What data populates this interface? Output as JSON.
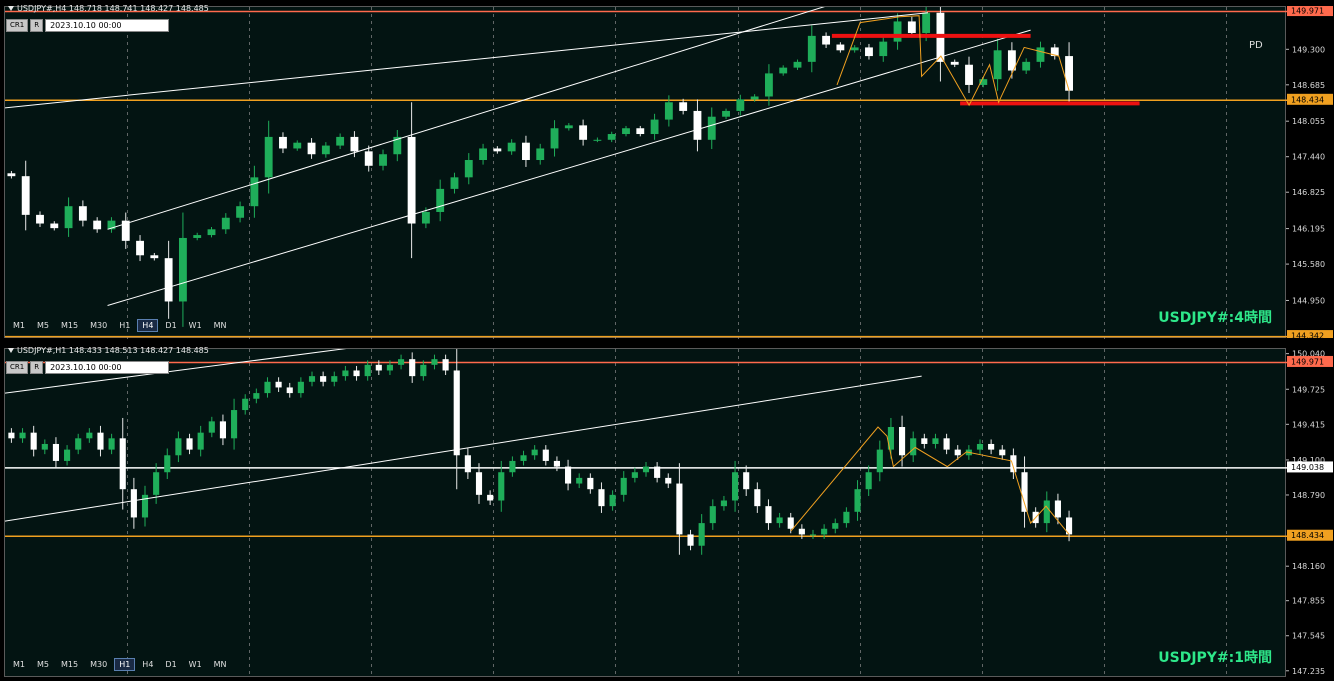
{
  "panels": [
    {
      "header": "USDJPY#,H4  148.718 148.741 148.427 148.485",
      "btn_cr": "CR1",
      "btn_r": "R",
      "datetime": "2023.10.10 00:00",
      "timeframes": [
        "M1",
        "M5",
        "M15",
        "M30",
        "H1",
        "H4",
        "D1",
        "W1",
        "MN"
      ],
      "active_timeframe": "H4",
      "watermark": "USDJPY#:4時間",
      "extra_label": "PD",
      "axis_ticks": [
        "149.300",
        "148.685",
        "148.055",
        "147.440",
        "146.825",
        "146.195",
        "145.580",
        "144.950"
      ],
      "price_tags": [
        {
          "label": "149.971",
          "value": 149.971,
          "color": "#ff6a4d"
        },
        {
          "label": "148.434",
          "value": 148.434,
          "color": "#f0a020"
        },
        {
          "label": "144.342",
          "value": 144.342,
          "color": "#f0a020"
        }
      ]
    },
    {
      "header": "USDJPY#,H1  148.433 148.513 148.427 148.485",
      "btn_cr": "CR1",
      "btn_r": "R",
      "datetime": "2023.10.10 00:00",
      "timeframes": [
        "M1",
        "M5",
        "M15",
        "M30",
        "H1",
        "H4",
        "D1",
        "W1",
        "MN"
      ],
      "active_timeframe": "H1",
      "watermark": "USDJPY#:1時間",
      "axis_ticks": [
        "150.040",
        "149.725",
        "149.415",
        "149.100",
        "148.790",
        "148.160",
        "147.855",
        "147.545",
        "147.235"
      ],
      "price_tags": [
        {
          "label": "149.971",
          "value": 149.971,
          "color": "#ff6a4d"
        },
        {
          "label": "149.038",
          "value": 149.038,
          "color": "#ffffff"
        },
        {
          "label": "148.434",
          "value": 148.434,
          "color": "#f0a020"
        }
      ]
    }
  ],
  "chart_data": [
    {
      "type": "candlestick",
      "symbol": "USDJPY#",
      "timeframe": "H4",
      "ylim": [
        144.3,
        150.05
      ],
      "last": {
        "open": 148.718,
        "high": 148.741,
        "low": 148.427,
        "close": 148.485
      },
      "horizontal_lines": [
        {
          "value": 149.971,
          "color": "#ff6a4d"
        },
        {
          "value": 148.434,
          "color": "#f0a020"
        },
        {
          "value": 144.342,
          "color": "#f0a020"
        }
      ],
      "closes": [
        147.12,
        146.45,
        146.3,
        146.22,
        146.6,
        146.35,
        146.2,
        146.35,
        146.0,
        145.75,
        145.7,
        144.95,
        146.05,
        146.1,
        146.2,
        146.4,
        146.6,
        147.1,
        147.8,
        147.6,
        147.7,
        147.5,
        147.65,
        147.8,
        147.55,
        147.3,
        147.5,
        147.8,
        146.3,
        146.5,
        146.9,
        147.1,
        147.4,
        147.6,
        147.55,
        147.7,
        147.4,
        147.6,
        147.95,
        148.0,
        147.75,
        147.75,
        147.85,
        147.95,
        147.85,
        148.1,
        148.4,
        148.25,
        147.75,
        148.15,
        148.25,
        148.45,
        148.5,
        148.9,
        149.0,
        149.1,
        149.55,
        149.4,
        149.3,
        149.35,
        149.2,
        149.45,
        149.8,
        149.6,
        149.95,
        149.1,
        149.05,
        148.7,
        148.8,
        149.3,
        148.95,
        149.1,
        149.35,
        149.2,
        148.6
      ],
      "white_lines": [
        {
          "from": [
            -0.01,
            148.28
          ],
          "to": [
            0.72,
            149.95
          ]
        },
        {
          "from": [
            0.08,
            146.2
          ],
          "to": [
            0.66,
            150.2
          ]
        },
        {
          "from": [
            0.08,
            144.88
          ],
          "to": [
            0.8,
            149.65
          ]
        }
      ],
      "red_levels": [
        {
          "from": 0.645,
          "to": 0.8,
          "value": 149.55
        },
        {
          "from": 0.745,
          "to": 0.885,
          "value": 148.38
        }
      ],
      "zigzag": [
        {
          "x": 0.649,
          "y": 148.7
        },
        {
          "x": 0.667,
          "y": 149.78
        },
        {
          "x": 0.698,
          "y": 149.88
        },
        {
          "x": 0.713,
          "y": 149.9
        },
        {
          "x": 0.715,
          "y": 148.85
        },
        {
          "x": 0.73,
          "y": 149.2
        },
        {
          "x": 0.752,
          "y": 148.35
        },
        {
          "x": 0.768,
          "y": 149.05
        },
        {
          "x": 0.775,
          "y": 148.4
        },
        {
          "x": 0.795,
          "y": 149.35
        },
        {
          "x": 0.822,
          "y": 149.2
        },
        {
          "x": 0.83,
          "y": 148.6
        }
      ]
    },
    {
      "type": "candlestick",
      "symbol": "USDJPY#",
      "timeframe": "H1",
      "ylim": [
        147.18,
        150.09
      ],
      "last": {
        "open": 148.433,
        "high": 148.513,
        "low": 148.427,
        "close": 148.485
      },
      "horizontal_lines": [
        {
          "value": 149.971,
          "color": "#ff6a4d"
        },
        {
          "value": 149.038,
          "color": "#ffffff"
        },
        {
          "value": 148.434,
          "color": "#f0a020"
        }
      ],
      "closes": [
        149.3,
        149.35,
        149.2,
        149.25,
        149.1,
        149.2,
        149.3,
        149.35,
        149.2,
        149.3,
        148.85,
        148.6,
        148.8,
        149.0,
        149.15,
        149.3,
        149.2,
        149.35,
        149.45,
        149.3,
        149.55,
        149.65,
        149.7,
        149.8,
        149.75,
        149.7,
        149.8,
        149.85,
        149.8,
        149.85,
        149.9,
        149.85,
        149.95,
        149.9,
        149.95,
        150.0,
        149.85,
        149.95,
        150.0,
        149.9,
        149.15,
        149.0,
        148.8,
        148.75,
        149.0,
        149.1,
        149.15,
        149.2,
        149.1,
        149.05,
        148.9,
        148.95,
        148.85,
        148.7,
        148.8,
        148.95,
        149.0,
        149.05,
        148.95,
        148.9,
        148.45,
        148.35,
        148.55,
        148.7,
        148.75,
        149.0,
        148.85,
        148.7,
        148.55,
        148.6,
        148.5,
        148.45,
        148.45,
        148.5,
        148.55,
        148.65,
        148.85,
        149.0,
        149.2,
        149.4,
        149.15,
        149.3,
        149.25,
        149.3,
        149.2,
        149.15,
        149.2,
        149.25,
        149.2,
        149.15,
        149.0,
        148.65,
        148.55,
        148.75,
        148.6,
        148.45
      ],
      "white_lines": [
        {
          "from": [
            -0.01,
            148.55
          ],
          "to": [
            0.715,
            149.85
          ]
        },
        {
          "from": [
            0.0,
            149.7
          ],
          "to": [
            0.27,
            150.1
          ]
        }
      ],
      "zigzag": [
        {
          "x": 0.613,
          "y": 148.48
        },
        {
          "x": 0.681,
          "y": 149.4
        },
        {
          "x": 0.688,
          "y": 149.32
        },
        {
          "x": 0.693,
          "y": 149.05
        },
        {
          "x": 0.71,
          "y": 149.22
        },
        {
          "x": 0.735,
          "y": 149.05
        },
        {
          "x": 0.75,
          "y": 149.18
        },
        {
          "x": 0.785,
          "y": 149.1
        },
        {
          "x": 0.8,
          "y": 148.55
        },
        {
          "x": 0.812,
          "y": 148.7
        },
        {
          "x": 0.83,
          "y": 148.45
        }
      ]
    }
  ]
}
